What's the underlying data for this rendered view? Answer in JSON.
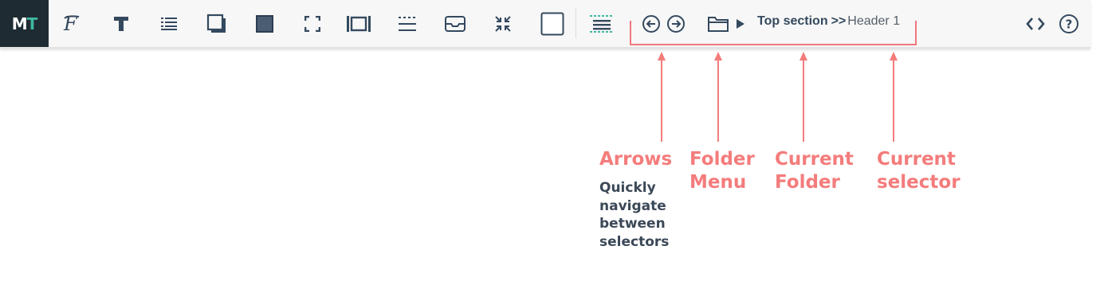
{
  "logo": {
    "m": "M",
    "t": "T"
  },
  "toolbar": {
    "tools": [
      {
        "icon": "font-family-icon"
      },
      {
        "icon": "text-weight-icon"
      },
      {
        "icon": "align-text-icon"
      },
      {
        "icon": "shadow-icon"
      },
      {
        "icon": "background-fill-icon"
      },
      {
        "icon": "corners-icon"
      },
      {
        "icon": "padding-icon"
      },
      {
        "icon": "border-dashed-icon"
      },
      {
        "icon": "inbox-icon"
      },
      {
        "icon": "collapse-icon"
      },
      {
        "icon": "empty-box-icon"
      },
      {
        "icon": "list-lines-icon"
      }
    ],
    "nav": {
      "back_icon": "arrow-left-circle-icon",
      "forward_icon": "arrow-right-circle-icon",
      "folder_icon": "folder-icon",
      "play_icon": "play-icon"
    },
    "breadcrumb": {
      "top": "Top section",
      "separator": ">>",
      "current": "Header 1"
    },
    "right": {
      "code_icon": "code-icon",
      "help_icon": "help-icon"
    }
  },
  "annotations": {
    "color": "#f47c7c",
    "arrows": "Arrows",
    "arrows_desc": "Quickly\nnavigate\nbetween\nselectors",
    "folder_menu": "Folder\nMenu",
    "current_folder": "Current\nFolder",
    "current_selector": "Current\nselector"
  }
}
